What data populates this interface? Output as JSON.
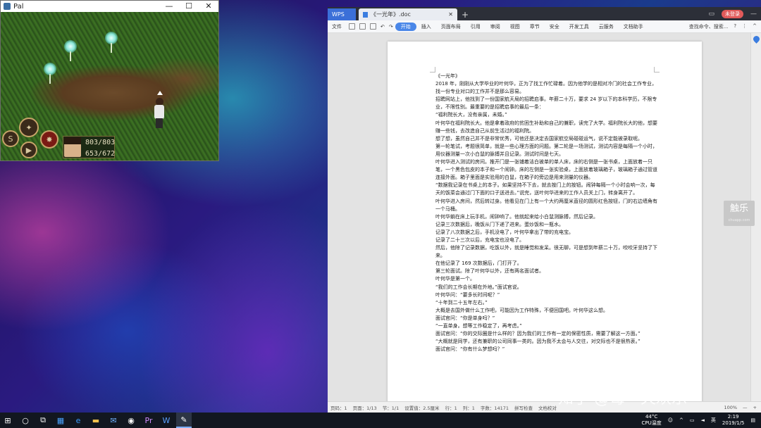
{
  "pal_window": {
    "title": "Pal",
    "buttons": {
      "minimize": "—",
      "maximize": "☐",
      "close": "✕"
    },
    "hud": {
      "hp": "803/803",
      "mp": "653/672"
    }
  },
  "wps": {
    "tabs": [
      {
        "label": "WPS"
      },
      {
        "label": "《一光年》.doc",
        "close": "✕"
      }
    ],
    "new_tab": "+",
    "login_label": "未登录",
    "menu": {
      "file": "文件",
      "items": [
        "开始",
        "插入",
        "页面布局",
        "引用",
        "审阅",
        "视图",
        "章节",
        "安全",
        "开发工具",
        "云服务",
        "文档助手"
      ],
      "active": "开始",
      "search": "查找命令、搜索...",
      "help": "?",
      "more": "⋮",
      "collapse": "^"
    },
    "document": {
      "paragraphs": [
        "《一光年》",
        "2018 年，刚刚从大学毕业的叶何华，正为了找工作忙碌着。因为他学的是相对冷门的社会工作专业，找一份专业对口的工作并不是那么容易。",
        "招聘网站上，他找到了一份国家航天局的招聘启事。年薪二十万，要求 24 岁以下的本科学历，不限专业，不限性别。最重要的是招聘启事的最后一条：",
        "“福利院长大，没有亲属，未婚。”",
        "叶何华在福利院长大。他是拿着政府的贫困生补助和自己的兼职，读完了大学。福利院长大的他，想要赚一些钱，去改造自己从前生活过的福利院。",
        "想了想，虽然自己并不是非常优秀，可他还是决定去国家航空局碰碰运气，说不定能被录取呢。",
        "第一轮笔试，考题很简单，就是一些心理方面的问题。第二轮是一场测试，测试内容是每隔一个小时，用仪器测量一次小白鼠的脉搏并且记录。测试时间是七天。",
        "叶何华进入测试的房间。推开门是一张铺着洁白被单的单人床，床的右侧是一张书桌，上面放着一只笔，一个黑色包皮的本子和一个闹钟。床的左侧是一张实验桌，上面放着玻璃箱子，玻璃箱子通过管道连接外面。箱子里面是实验用的白鼠，在箱子的旁边是用来测量的仪器。",
        "“数据我记录在书桌上的本子。如果坚持不下去，就去按门上的按钮。闹钟每隔一个小时会响一次，每天的饭菜会通过门下面的口子送进去。”说完，送叶何华进来的工作人员关上门，转身离开了。",
        "叶何华进入房间，然后转过身。他看见在门上有一个大约两厘米直径的圆形红色按钮，门的右边墙角有一个马桶。",
        "叶何华躺在床上玩手机，闹钟响了。他就起来给小白鼠测脉搏，然后记录。",
        "记录三次数据后，晚饭从门下递了进来。蛋炒饭和一瓶水。",
        "记录了八次数据之后，手机没电了，叶何华拿出了带的充电宝。",
        "记录了二十三次以后，充电宝也没电了。",
        "然后，他除了记录数据，吃饭以外，就是睡觉和发呆。很无聊，可是想到年薪二十万，咬咬牙坚持了下来。",
        "在他记录了 169 次数据后，门打开了。",
        "第三轮面试。除了叶何华以外，还有两名面试者。",
        "叶何华是第一个。",
        "“我们的工作会长期在外地。”面试官说。",
        "叶何华问：“要多长时间呢？”",
        "“十年到二十五年左右。”",
        "大概是去国外做什么工作吧，可能因为工作特殊，不便回国吧。叶何华这么想。",
        "面试官问：“你是单身吗？”",
        "“一直单身。想等工作稳定了，再考虑。”",
        "面试官问：“你的交际圈是什么样的？因为我们的工作有一定的保密性质，需要了解这一方面。”",
        "“大概就是同学，还有兼职的公司同事一类的。因为我不太会与人交往，对交际也不是很热衷。”",
        "面试官问：“你有什么梦想吗？”"
      ]
    },
    "status": {
      "page_num": "页码：1",
      "pages": "页面：1/13",
      "section": "节：1/1",
      "setting": "设置值：2.5厘米",
      "line": "行：1",
      "col": "列：1",
      "words": "字数：14171",
      "spell": "拼写检查",
      "doc_check": "文档校对",
      "zoom": "100%",
      "zoom_out": "—",
      "zoom_in": "+"
    },
    "side_brand": {
      "main": "触乐",
      "sub": "chuapp.com"
    }
  },
  "watermark": "知乎 @每一天欢乐",
  "taskbar": {
    "items": [
      "start",
      "search",
      "task-view",
      "store",
      "edge",
      "explorer",
      "mail",
      "media",
      "premiere",
      "wps-writer",
      "pal"
    ],
    "tray": {
      "temp": "44°C",
      "cpu": "CPU温度",
      "lang": "英",
      "time": "2:19",
      "date": "2019/1/5"
    }
  }
}
